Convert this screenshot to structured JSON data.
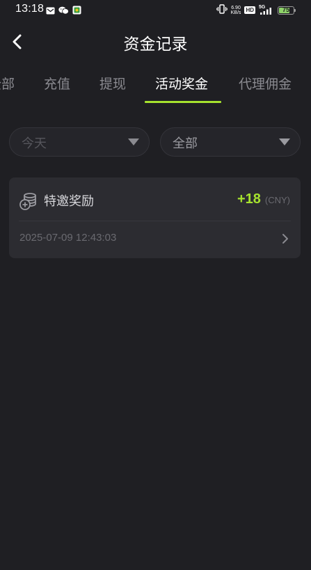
{
  "status_bar": {
    "time": "13:18",
    "net_speed_value": "6.90",
    "net_speed_unit": "KB/s",
    "hd_badge": "HD",
    "network_type": "5G",
    "battery_level": "75",
    "battery_fraction": 0.75,
    "left_icons": [
      "mail-notification-icon",
      "wechat-icon",
      "app-notification-icon"
    ],
    "right_icons": [
      "vibrate-icon",
      "hd-icon",
      "signal-5g-icon",
      "battery-icon"
    ]
  },
  "header": {
    "title": "资金记录",
    "back_icon": "chevron-left-icon"
  },
  "tabs": {
    "items": [
      {
        "label": "全部"
      },
      {
        "label": "充值"
      },
      {
        "label": "提现"
      },
      {
        "label": "活动奖金"
      },
      {
        "label": "代理佣金"
      }
    ],
    "active_index": 3,
    "accent_color": "#a6e22e"
  },
  "filters": {
    "date": {
      "value": "今天",
      "icon": "caret-down-icon"
    },
    "type": {
      "value": "全部",
      "icon": "caret-down-icon"
    }
  },
  "records": [
    {
      "icon": "coins-plus-icon",
      "title": "特邀奖励",
      "amount": "+18",
      "currency": "(CNY)",
      "time": "2025-07-09 12:43:03",
      "action_icon": "chevron-right-icon"
    }
  ],
  "colors": {
    "background": "#1f1f23",
    "card": "#2c2c31",
    "accent": "#a6e22e",
    "muted_text": "#6a6a70"
  }
}
